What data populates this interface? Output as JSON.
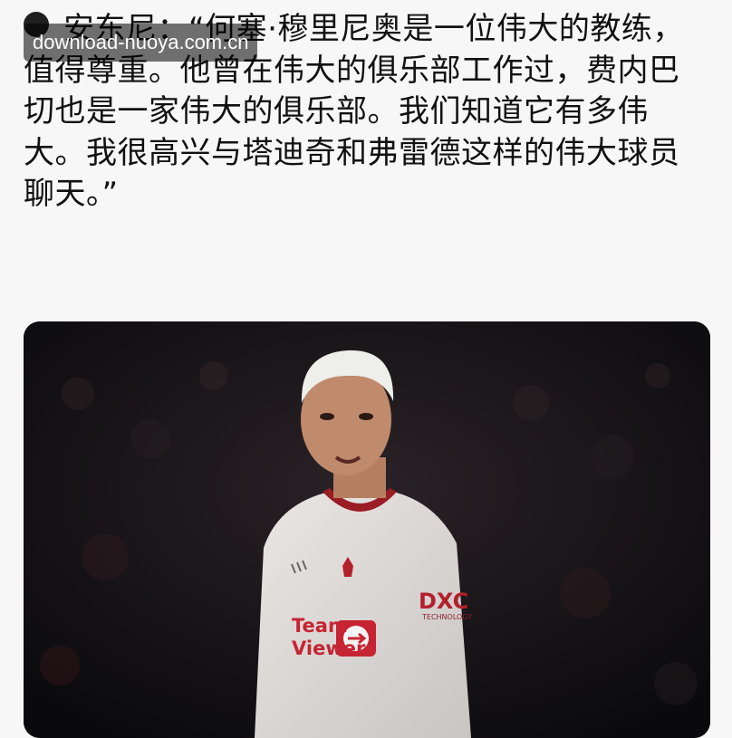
{
  "post": {
    "lines": [
      "安东尼：“何塞·穆里尼奥是一位伟大的教练，",
      "值得尊重。他曾在伟大的俱乐部工作过，费内巴",
      "切也是一家伟大的俱乐部。我们知道它有多伟",
      "大。我很高兴与塔迪奇和弗雷德这样的伟大球员",
      "聊天。”"
    ]
  },
  "watermark": {
    "text": "download-nuoya.com.cn"
  },
  "photo": {
    "subject": "footballer-photo",
    "sponsor_text": [
      "Team",
      "Viewer"
    ],
    "sleeve_text": "DXC",
    "sleeve_subtext": "TECHNOLOGY"
  }
}
